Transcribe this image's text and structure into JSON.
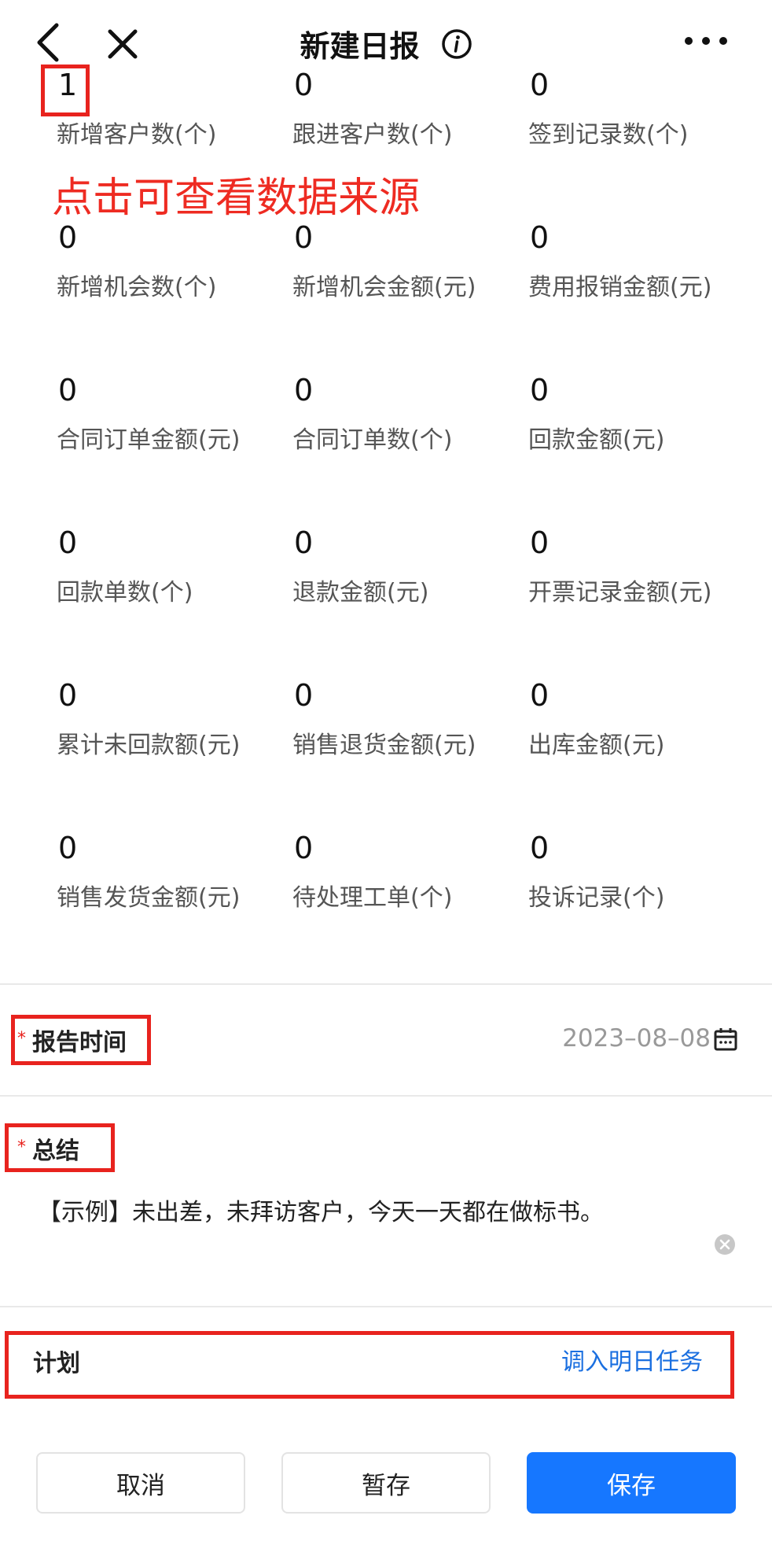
{
  "header": {
    "title": "新建日报"
  },
  "stats": [
    {
      "value": "1",
      "label": "新增客户数(个)"
    },
    {
      "value": "0",
      "label": "跟进客户数(个)"
    },
    {
      "value": "0",
      "label": "签到记录数(个)"
    },
    {
      "value": "0",
      "label": "新增机会数(个)"
    },
    {
      "value": "0",
      "label": "新增机会金额(元)"
    },
    {
      "value": "0",
      "label": "费用报销金额(元)"
    },
    {
      "value": "0",
      "label": "合同订单金额(元)"
    },
    {
      "value": "0",
      "label": "合同订单数(个)"
    },
    {
      "value": "0",
      "label": "回款金额(元)"
    },
    {
      "value": "0",
      "label": "回款单数(个)"
    },
    {
      "value": "0",
      "label": "退款金额(元)"
    },
    {
      "value": "0",
      "label": "开票记录金额(元)"
    },
    {
      "value": "0",
      "label": "累计未回款额(元)"
    },
    {
      "value": "0",
      "label": "销售退货金额(元)"
    },
    {
      "value": "0",
      "label": "出库金额(元)"
    },
    {
      "value": "0",
      "label": "销售发货金额(元)"
    },
    {
      "value": "0",
      "label": "待处理工单(个)"
    },
    {
      "value": "0",
      "label": "投诉记录(个)"
    }
  ],
  "annotation": {
    "text": "点击可查看数据来源",
    "color": "#ee2b22"
  },
  "report_time": {
    "required_mark": "*",
    "label": "报告时间",
    "value": "2023–08–08"
  },
  "summary": {
    "required_mark": "*",
    "label": "总结",
    "text": "【示例】未出差，未拜访客户，今天一天都在做标书。"
  },
  "plan": {
    "label": "计划",
    "action_label": "调入明日任务"
  },
  "buttons": {
    "cancel": "取消",
    "draft": "暂存",
    "save": "保存"
  },
  "colors": {
    "primary": "#1677ff",
    "link": "#1a6fe0",
    "annotation_red": "#e8231e"
  }
}
